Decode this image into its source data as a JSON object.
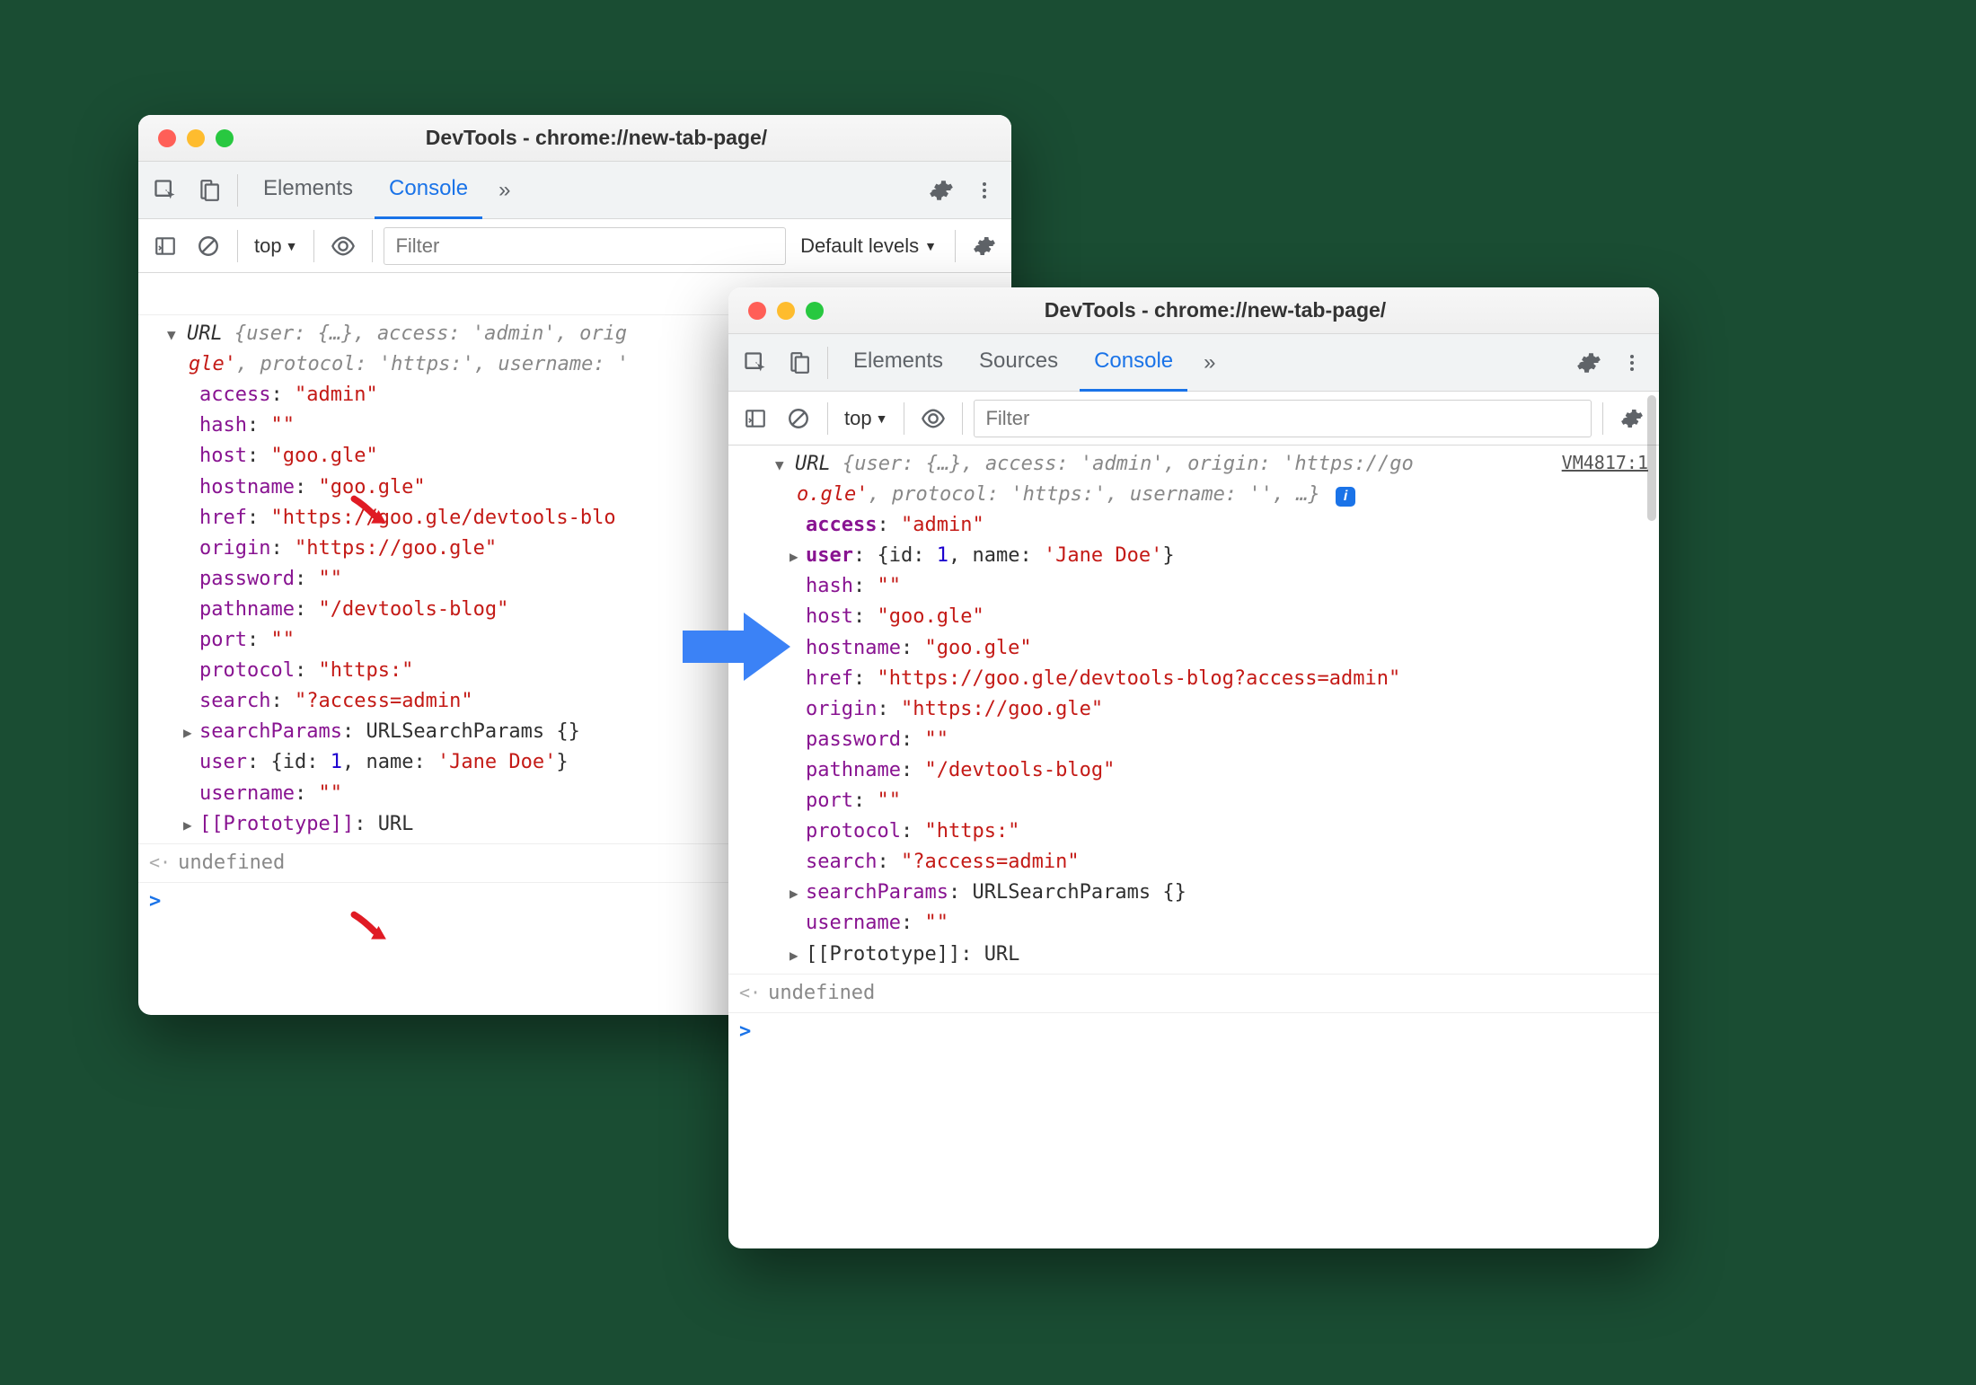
{
  "leftWindow": {
    "title": "DevTools - chrome://new-tab-page/",
    "tabs": {
      "elements": "Elements",
      "console": "Console"
    },
    "toolbar": {
      "context": "top",
      "filter_placeholder": "Filter",
      "levels": "Default levels"
    },
    "summary_prefix": "URL",
    "summary_inline": "{user: {…}, access: 'admin', orig",
    "summary_line2": "gle'",
    "summary_line2b": ", protocol: 'https:', username: '",
    "props": {
      "access": {
        "k": "access",
        "v": "\"admin\""
      },
      "hash": {
        "k": "hash",
        "v": "\"\""
      },
      "host": {
        "k": "host",
        "v": "\"goo.gle\""
      },
      "hostname": {
        "k": "hostname",
        "v": "\"goo.gle\""
      },
      "href": {
        "k": "href",
        "v": "\"https://goo.gle/devtools-blo"
      },
      "origin": {
        "k": "origin",
        "v": "\"https://goo.gle\""
      },
      "password": {
        "k": "password",
        "v": "\"\""
      },
      "pathname": {
        "k": "pathname",
        "v": "\"/devtools-blog\""
      },
      "port": {
        "k": "port",
        "v": "\"\""
      },
      "protocol": {
        "k": "protocol",
        "v": "\"https:\""
      },
      "search": {
        "k": "search",
        "v": "\"?access=admin\""
      },
      "searchParams": {
        "k": "searchParams",
        "v": "URLSearchParams {}"
      },
      "user": {
        "k": "user",
        "pre": "{id: ",
        "id": "1",
        "mid": ", name: ",
        "name": "'Jane Doe'",
        "post": "}"
      },
      "username": {
        "k": "username",
        "v": "\"\""
      },
      "proto": {
        "k": "[[Prototype]]",
        "v": "URL"
      }
    },
    "undefined": "undefined"
  },
  "rightWindow": {
    "title": "DevTools - chrome://new-tab-page/",
    "tabs": {
      "elements": "Elements",
      "sources": "Sources",
      "console": "Console"
    },
    "toolbar": {
      "context": "top",
      "filter_placeholder": "Filter"
    },
    "vm": "VM4817:1",
    "summary_prefix": "URL",
    "summary_l1": "{user: {…}, access: 'admin', origin: 'https://go",
    "summary_l2a": "o.gle'",
    "summary_l2b": ", protocol: 'https:', username: '', …}",
    "props": {
      "access": {
        "k": "access",
        "v": "\"admin\""
      },
      "user": {
        "k": "user",
        "pre": "{id: ",
        "id": "1",
        "mid": ", name: ",
        "name": "'Jane Doe'",
        "post": "}"
      },
      "hash": {
        "k": "hash",
        "v": "\"\""
      },
      "host": {
        "k": "host",
        "v": "\"goo.gle\""
      },
      "hostname": {
        "k": "hostname",
        "v": "\"goo.gle\""
      },
      "href": {
        "k": "href",
        "v": "\"https://goo.gle/devtools-blog?access=admin\""
      },
      "origin": {
        "k": "origin",
        "v": "\"https://goo.gle\""
      },
      "password": {
        "k": "password",
        "v": "\"\""
      },
      "pathname": {
        "k": "pathname",
        "v": "\"/devtools-blog\""
      },
      "port": {
        "k": "port",
        "v": "\"\""
      },
      "protocol": {
        "k": "protocol",
        "v": "\"https:\""
      },
      "search": {
        "k": "search",
        "v": "\"?access=admin\""
      },
      "searchParams": {
        "k": "searchParams",
        "v": "URLSearchParams {}"
      },
      "username": {
        "k": "username",
        "v": "\"\""
      },
      "proto": {
        "k": "[[Prototype]]",
        "v": "URL"
      }
    },
    "undefined": "undefined"
  }
}
